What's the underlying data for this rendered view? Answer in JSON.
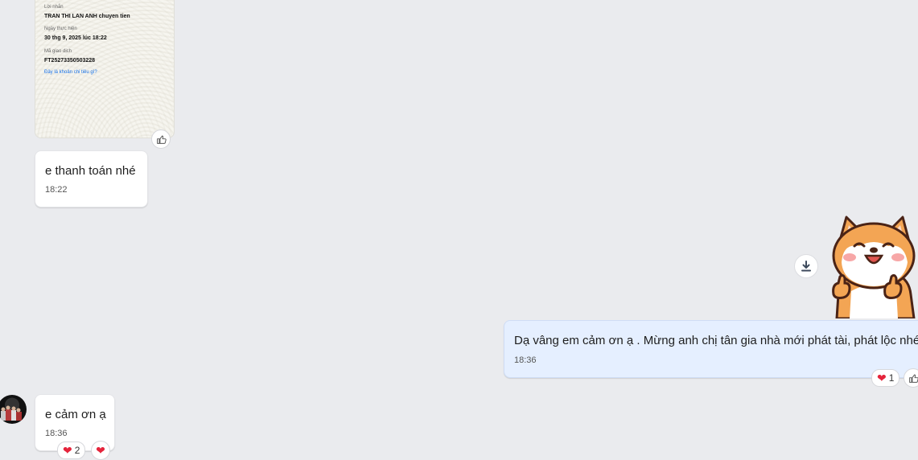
{
  "receipt": {
    "message_label": "Lời nhắn",
    "message_value": "TRAN THI LAN ANH chuyen tien",
    "date_label": "Ngày thực hiện",
    "date_value": "30 thg 9, 2025 lúc 18:22",
    "txn_label": "Mã giao dịch",
    "txn_value": "FT25273350503228",
    "link": "Đây là khoản chi tiêu gì?"
  },
  "messages": [
    {
      "text": "e thanh toán nhé",
      "time": "18:22"
    },
    {
      "text": "Dạ vâng em cảm ơn ạ . Mừng anh chị tân gia nhà mới phát tài, phát lộc nhé",
      "time": "18:36",
      "reaction_count": "1"
    },
    {
      "text": "e cảm ơn ạ",
      "time": "18:36",
      "reaction_count": "2"
    }
  ],
  "icons": {
    "like": "thumbs-up-icon",
    "download": "download-icon",
    "heart": "heart-icon",
    "sticker": "shiba-dog-thumbs-up-sticker"
  },
  "colors": {
    "background": "#eaebee",
    "mine_bubble": "#e5efff",
    "heart": "#e5243b"
  }
}
